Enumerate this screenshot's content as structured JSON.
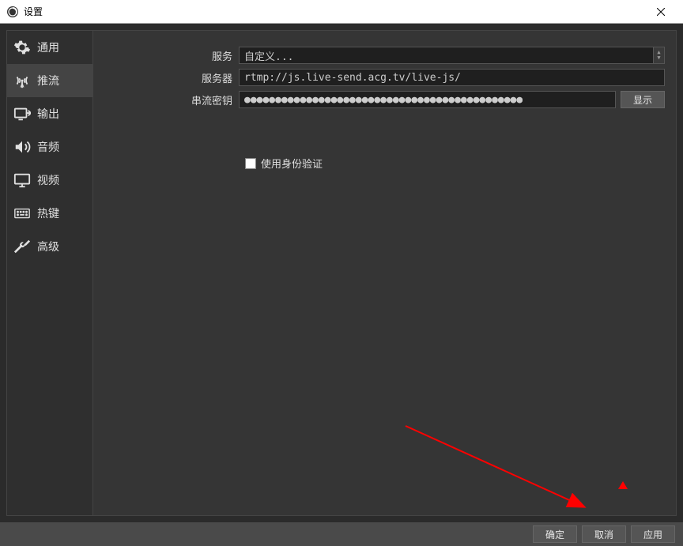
{
  "window": {
    "title": "设置"
  },
  "sidebar": {
    "items": [
      {
        "id": "general",
        "label": "通用"
      },
      {
        "id": "stream",
        "label": "推流"
      },
      {
        "id": "output",
        "label": "输出"
      },
      {
        "id": "audio",
        "label": "音频"
      },
      {
        "id": "video",
        "label": "视频"
      },
      {
        "id": "hotkeys",
        "label": "热键"
      },
      {
        "id": "advanced",
        "label": "高级"
      }
    ],
    "selected": "stream"
  },
  "form": {
    "service_label": "服务",
    "service_value": "自定义...",
    "server_label": "服务器",
    "server_value": "rtmp://js.live-send.acg.tv/live-js/",
    "stream_key_label": "串流密钥",
    "stream_key_masked": "●●●●●●●●●●●●●●●●●●●●●●●●●●●●●●●●●●●●●●●●●●●●●",
    "show_button": "显示",
    "use_auth_label": "使用身份验证",
    "use_auth_checked": false
  },
  "footer": {
    "ok": "确定",
    "cancel": "取消",
    "apply": "应用"
  },
  "annotation": {
    "arrow_color": "#ff0000"
  }
}
